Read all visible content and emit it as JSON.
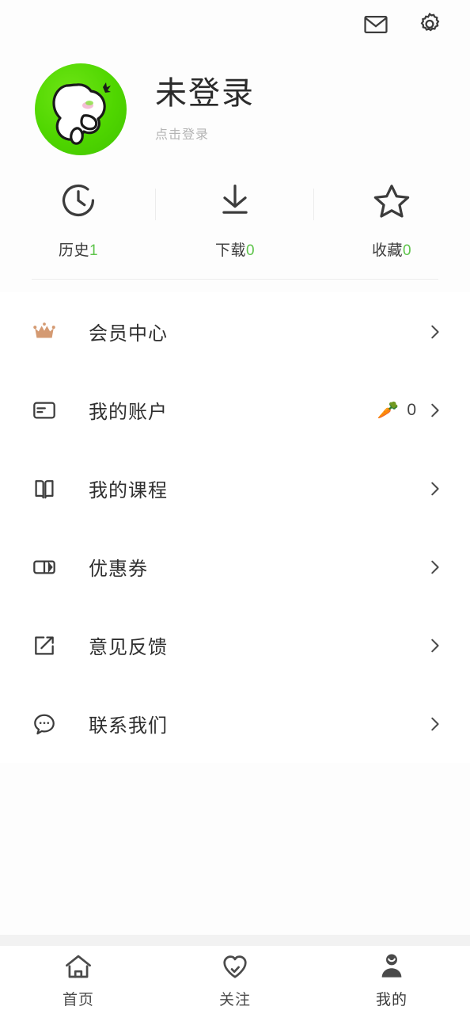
{
  "topbar": {
    "mail_icon": "mail-icon",
    "settings_icon": "gear-icon"
  },
  "profile": {
    "avatar_icon": "rabbit-avatar",
    "avatar_bg": "#4fd600",
    "name": "未登录",
    "subtitle": "点击登录"
  },
  "stats": {
    "items": [
      {
        "icon": "history-clock-icon",
        "label": "历史",
        "count": "1"
      },
      {
        "icon": "download-icon",
        "label": "下载",
        "count": "0"
      },
      {
        "icon": "star-favorite-icon",
        "label": "收藏",
        "count": "0"
      }
    ],
    "count_color": "#5ec44b"
  },
  "menu": {
    "items": [
      {
        "icon": "crown-icon",
        "label": "会员中心",
        "value": "",
        "badge": ""
      },
      {
        "icon": "credit-card-icon",
        "label": "我的账户",
        "value": "0",
        "badge": "🥕"
      },
      {
        "icon": "book-icon",
        "label": "我的课程",
        "value": "",
        "badge": ""
      },
      {
        "icon": "coupon-ticket-icon",
        "label": "优惠券",
        "value": "",
        "badge": ""
      },
      {
        "icon": "edit-square-icon",
        "label": "意见反馈",
        "value": "",
        "badge": ""
      },
      {
        "icon": "chat-bubble-icon",
        "label": "联系我们",
        "value": "",
        "badge": ""
      }
    ],
    "chevron_icon": "chevron-right-icon",
    "crown_color": "#d49a72"
  },
  "bottomnav": {
    "items": [
      {
        "icon": "home-icon",
        "label": "首页",
        "active": false
      },
      {
        "icon": "heart-check-icon",
        "label": "关注",
        "active": false
      },
      {
        "icon": "person-icon",
        "label": "我的",
        "active": true
      }
    ]
  }
}
